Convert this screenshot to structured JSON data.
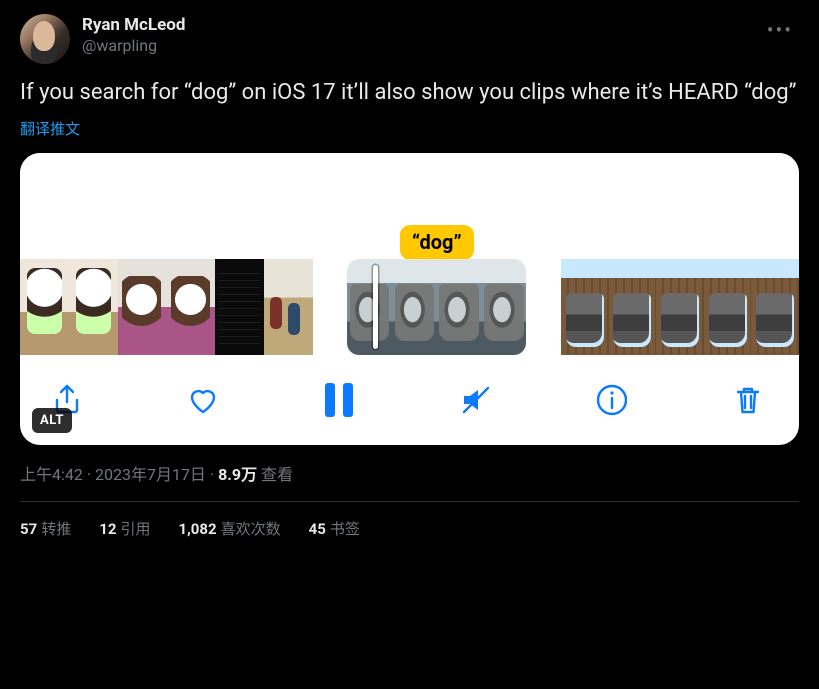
{
  "author": {
    "display_name": "Ryan McLeod",
    "handle": "@warpling"
  },
  "tweet": {
    "text": "If you search for “dog” on iOS 17 it’ll also show you clips where it’s HEARD “dog”",
    "translate_label": "翻译推文"
  },
  "media": {
    "caption_chip": "“dog”",
    "alt_badge": "ALT",
    "toolbar": {
      "share": "share",
      "like": "like",
      "pause": "pause",
      "mute": "mute",
      "info": "info",
      "trash": "trash"
    }
  },
  "meta": {
    "time": "上午4:42",
    "sep1": " · ",
    "date": "2023年7月17日",
    "sep2": " · ",
    "views_number": "8.9万",
    "views_label": " 查看"
  },
  "stats": {
    "retweets_n": "57",
    "retweets_l": "转推",
    "quotes_n": "12",
    "quotes_l": "引用",
    "likes_n": "1,082",
    "likes_l": "喜欢次数",
    "bookmarks_n": "45",
    "bookmarks_l": "书签"
  }
}
